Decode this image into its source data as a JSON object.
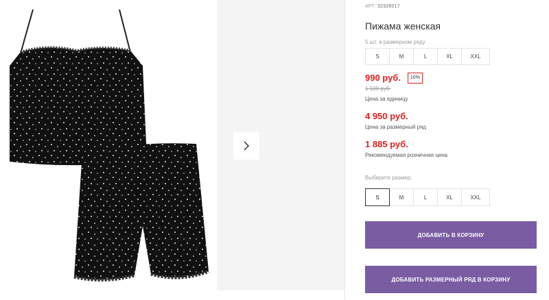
{
  "product": {
    "sku_label": "АРТ:",
    "sku_value": "32326017",
    "title": "Пижама женская"
  },
  "pack": {
    "label": "5 шт. в размерном ряду",
    "sizes": [
      "S",
      "M",
      "L",
      "XL",
      "XXL"
    ]
  },
  "prices": {
    "unit_price": "990 руб.",
    "discount": "10%",
    "old_price": "1 100 руб.",
    "unit_caption": "Цена за единицу",
    "pack_price": "4 950 руб.",
    "pack_caption": "Цена за размерный ряд",
    "retail_price": "1 885 руб.",
    "retail_caption": "Рекомендуемая розничная цена",
    "accent_color": "#e0221f"
  },
  "size_choice": {
    "label": "Выберите размер:",
    "sizes": [
      "S",
      "M",
      "L",
      "XL",
      "XXL"
    ],
    "selected": "S"
  },
  "buttons": {
    "add_to_cart": "ДОБАВИТЬ В КОРЗИНУ",
    "add_pack_to_cart": "ДОБАВИТЬ РАЗМЕРНЫЙ РЯД В КОРЗИНУ",
    "color": "#7a5ca3"
  },
  "gallery": {
    "next_icon": "chevron-right-icon"
  }
}
